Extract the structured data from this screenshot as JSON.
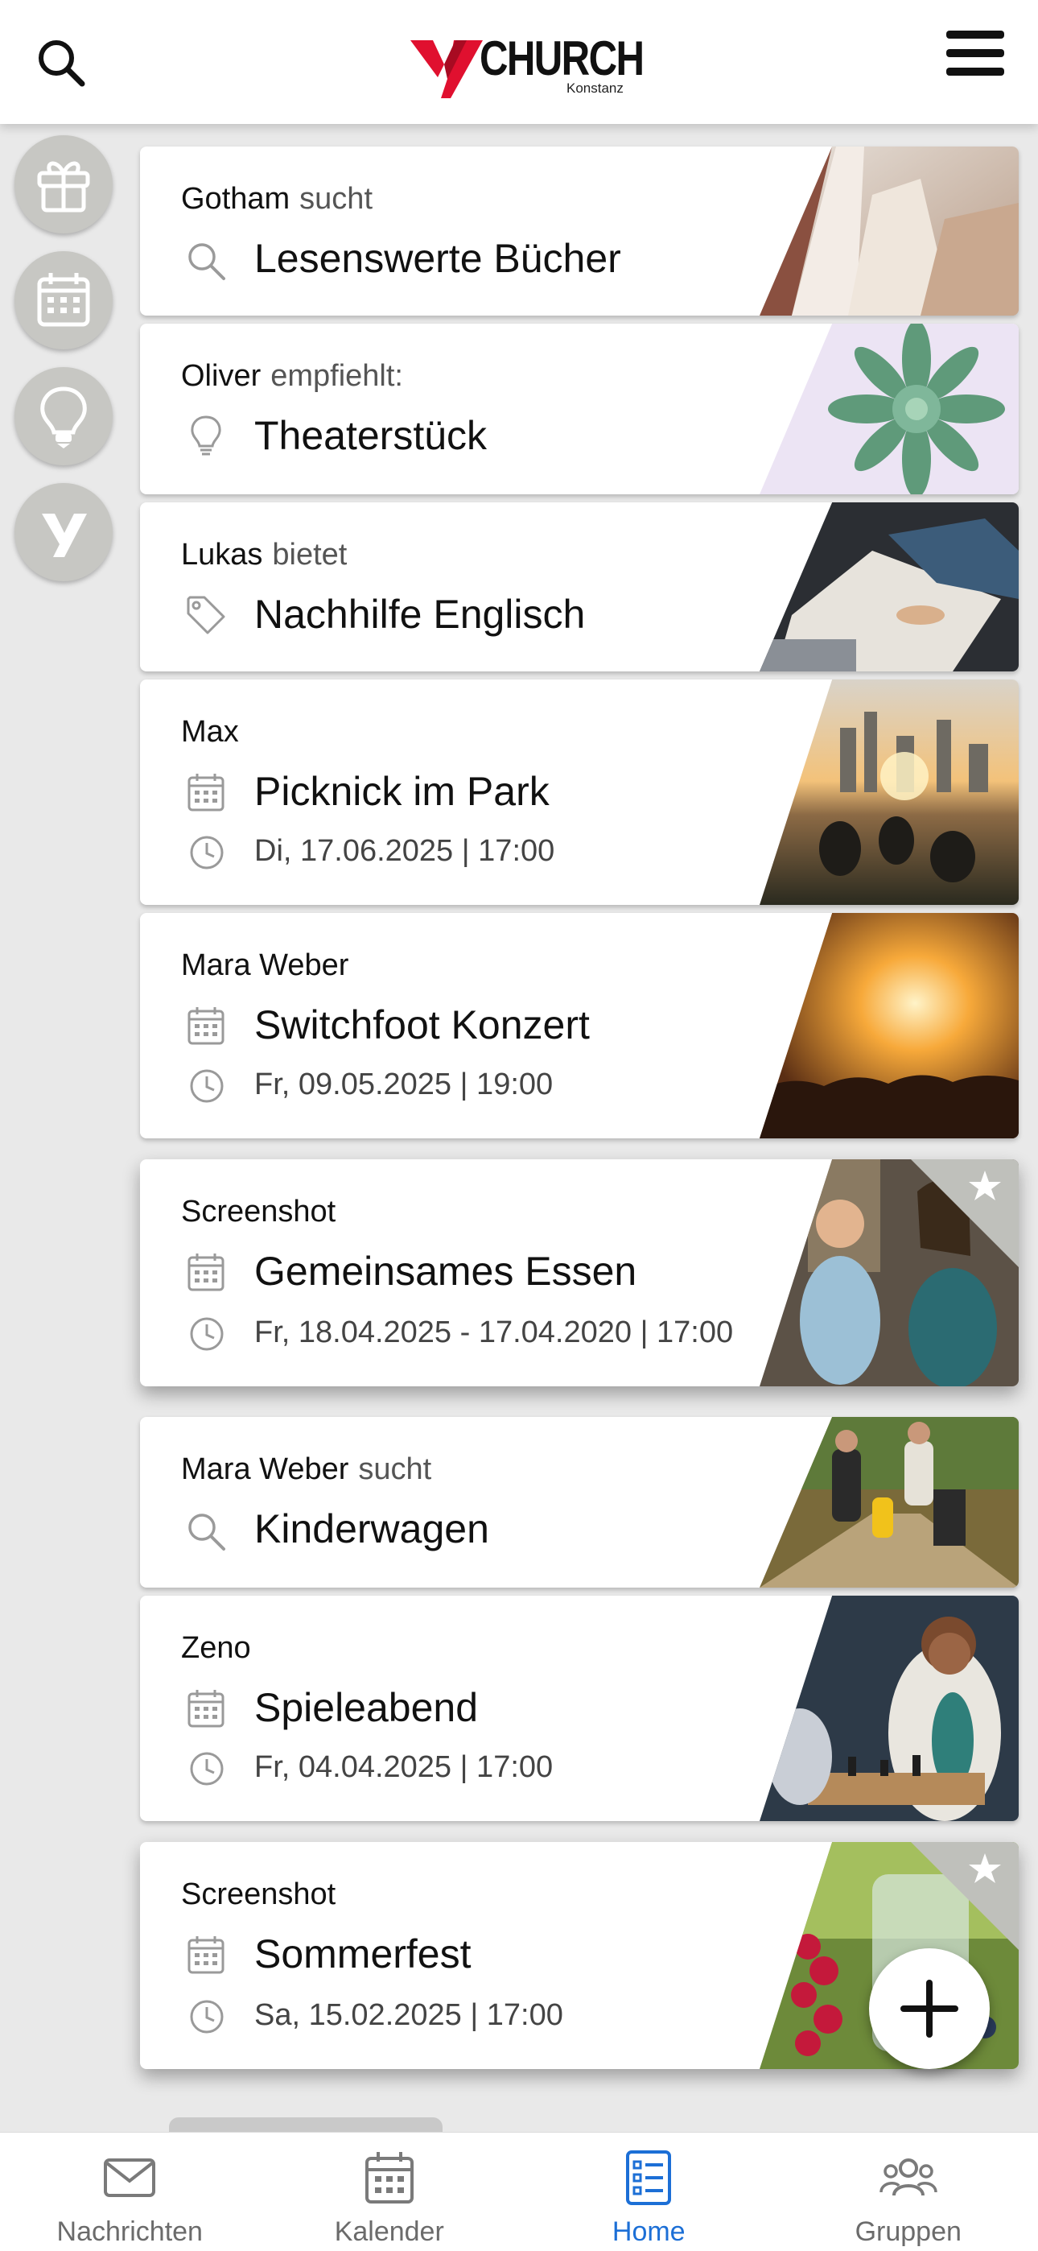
{
  "header": {
    "logo_text": "CHURCH",
    "logo_sub": "Konstanz",
    "brand_color": "#e0102f"
  },
  "side_buttons": [
    {
      "icon": "gift-icon"
    },
    {
      "icon": "calendar-icon"
    },
    {
      "icon": "lightbulb-icon"
    },
    {
      "icon": "y-logo-icon"
    }
  ],
  "cards": [
    {
      "author": "Gotham",
      "verb": "sucht",
      "icon": "search-icon",
      "title": "Lesenswerte Bücher"
    },
    {
      "author": "Oliver",
      "verb": "empfiehlt:",
      "icon": "lightbulb-icon",
      "title": "Theaterstück"
    },
    {
      "author": "Lukas",
      "verb": "bietet",
      "icon": "tag-icon",
      "title": "Nachhilfe Englisch"
    },
    {
      "author": "Max",
      "verb": "",
      "icon": "calendar-icon",
      "title": "Picknick im Park",
      "date": "Di, 17.06.2025 | 17:00"
    },
    {
      "author": "Mara Weber",
      "verb": "",
      "icon": "calendar-icon",
      "title": "Switchfoot Konzert",
      "date": "Fr, 09.05.2025 | 19:00"
    },
    {
      "author": "Screenshot",
      "verb": "",
      "icon": "calendar-icon",
      "title": "Gemeinsames Essen",
      "date": "Fr, 18.04.2025 - 17.04.2020 | 17:00",
      "starred": true
    },
    {
      "author": "Mara Weber",
      "verb": "sucht",
      "icon": "search-icon",
      "title": "Kinderwagen"
    },
    {
      "author": "Zeno",
      "verb": "",
      "icon": "calendar-icon",
      "title": "Spieleabend",
      "date": "Fr, 04.04.2025 | 17:00"
    },
    {
      "author": "Screenshot",
      "verb": "",
      "icon": "calendar-icon",
      "title": "Sommerfest",
      "date": "Sa, 15.02.2025 | 17:00",
      "starred": true
    }
  ],
  "bottom_nav": [
    {
      "label": "Nachrichten",
      "icon": "mail-icon"
    },
    {
      "label": "Kalender",
      "icon": "calendar-icon"
    },
    {
      "label": "Home",
      "icon": "list-icon",
      "active": true
    },
    {
      "label": "Gruppen",
      "icon": "group-icon"
    }
  ],
  "colors": {
    "accent": "#1c6fd6",
    "side_button": "#c7c7c3"
  }
}
